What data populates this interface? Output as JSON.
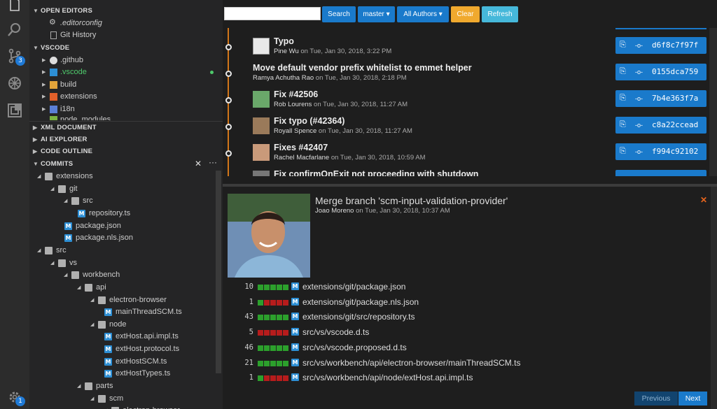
{
  "activity_bar": {
    "items": [
      {
        "name": "files-icon",
        "badge": ""
      },
      {
        "name": "search-icon",
        "badge": ""
      },
      {
        "name": "source-control-icon",
        "badge": "3"
      },
      {
        "name": "debug-icon",
        "badge": ""
      },
      {
        "name": "extensions-icon",
        "badge": ""
      }
    ],
    "settings_badge": "1"
  },
  "sidebar": {
    "open_editors": {
      "header": "OPEN EDITORS",
      "items": [
        {
          "label": ".editorconfig",
          "icon": "gear-icon"
        },
        {
          "label": "Git History",
          "icon": "document-icon"
        }
      ]
    },
    "vscode": {
      "header": "VSCODE",
      "items": [
        {
          "label": ".github",
          "icon": "github-icon"
        },
        {
          "label": ".vscode",
          "icon": "vscode-icon"
        },
        {
          "label": "build",
          "icon": "folder-icon"
        },
        {
          "label": "extensions",
          "icon": "folder-icon"
        },
        {
          "label": "i18n",
          "icon": "folder-icon"
        },
        {
          "label": "node_modules",
          "icon": "folder-icon"
        }
      ]
    },
    "collapsed_sections": [
      "XML DOCUMENT",
      "AI EXPLORER",
      "CODE OUTLINE"
    ],
    "commits": {
      "header": "COMMITS",
      "tree": [
        {
          "label": "extensions",
          "type": "folder"
        },
        {
          "label": "git",
          "type": "folder"
        },
        {
          "label": "src",
          "type": "folder"
        },
        {
          "label": "repository.ts",
          "type": "file"
        },
        {
          "label": "package.json",
          "type": "file"
        },
        {
          "label": "package.nls.json",
          "type": "file"
        },
        {
          "label": "src",
          "type": "folder"
        },
        {
          "label": "vs",
          "type": "folder"
        },
        {
          "label": "workbench",
          "type": "folder"
        },
        {
          "label": "api",
          "type": "folder"
        },
        {
          "label": "electron-browser",
          "type": "folder"
        },
        {
          "label": "mainThreadSCM.ts",
          "type": "file"
        },
        {
          "label": "node",
          "type": "folder"
        },
        {
          "label": "extHost.api.impl.ts",
          "type": "file"
        },
        {
          "label": "extHost.protocol.ts",
          "type": "file"
        },
        {
          "label": "extHostSCM.ts",
          "type": "file"
        },
        {
          "label": "extHostTypes.ts",
          "type": "file"
        },
        {
          "label": "parts",
          "type": "folder"
        },
        {
          "label": "scm",
          "type": "folder"
        },
        {
          "label": "electron-browser",
          "type": "folder"
        }
      ]
    }
  },
  "toolbar": {
    "search_value": "",
    "search_label": "Search",
    "branch_label": "master ▾",
    "authors_label": "All Authors ▾",
    "clear_label": "Clear",
    "refresh_label": "Refresh",
    "colors": {
      "blue": "#1a7acb",
      "clear": "#f0a92e",
      "refresh": "#46b8da"
    }
  },
  "commits": [
    {
      "title": "Typo",
      "author": "Pine Wu",
      "date": "on Tue, Jan 30, 2018, 3:22 PM",
      "sha": "d6f8c7f97f",
      "avatar": true
    },
    {
      "title": "Move default vendor prefix whitelist to emmet helper",
      "author": "Ramya Achutha Rao",
      "date": "on Tue, Jan 30, 2018, 2:18 PM",
      "sha": "0155dca759",
      "avatar": false
    },
    {
      "title": "Fix #42506",
      "author": "Rob Lourens",
      "date": "on Tue, Jan 30, 2018, 11:27 AM",
      "sha": "7b4e363f7a",
      "avatar": true
    },
    {
      "title": "Fix typo (#42364)",
      "author": "Royall Spence",
      "date": "on Tue, Jan 30, 2018, 11:27 AM",
      "sha": "c8a22ccead",
      "avatar": true
    },
    {
      "title": "Fixes #42407",
      "author": "Rachel Macfarlane",
      "date": "on Tue, Jan 30, 2018, 10:59 AM",
      "sha": "f994c92102",
      "avatar": true
    },
    {
      "title": "Fix confirmOnExit not proceeding with shutdown",
      "author": "",
      "date": "",
      "sha": "",
      "avatar": true
    }
  ],
  "details": {
    "title": "Merge branch 'scm-input-validation-provider'",
    "author": "Joao Moreno",
    "date": "on Tue, Jan 30, 2018, 10:37 AM",
    "files": [
      {
        "count": "10",
        "path": "extensions/git/package.json",
        "added": 5,
        "removed": 0
      },
      {
        "count": "1",
        "path": "extensions/git/package.nls.json",
        "added": 1,
        "removed": 4
      },
      {
        "count": "43",
        "path": "extensions/git/src/repository.ts",
        "added": 5,
        "removed": 0
      },
      {
        "count": "5",
        "path": "src/vs/vscode.d.ts",
        "added": 0,
        "removed": 5
      },
      {
        "count": "46",
        "path": "src/vs/vscode.proposed.d.ts",
        "added": 5,
        "removed": 0
      },
      {
        "count": "21",
        "path": "src/vs/workbench/api/electron-browser/mainThreadSCM.ts",
        "added": 5,
        "removed": 0
      },
      {
        "count": "1",
        "path": "src/vs/workbench/api/node/extHost.api.impl.ts",
        "added": 1,
        "removed": 4
      }
    ],
    "colors": {
      "added": "#2ca02c",
      "removed": "#b71c1c"
    }
  },
  "pager": {
    "previous": "Previous",
    "next": "Next"
  }
}
